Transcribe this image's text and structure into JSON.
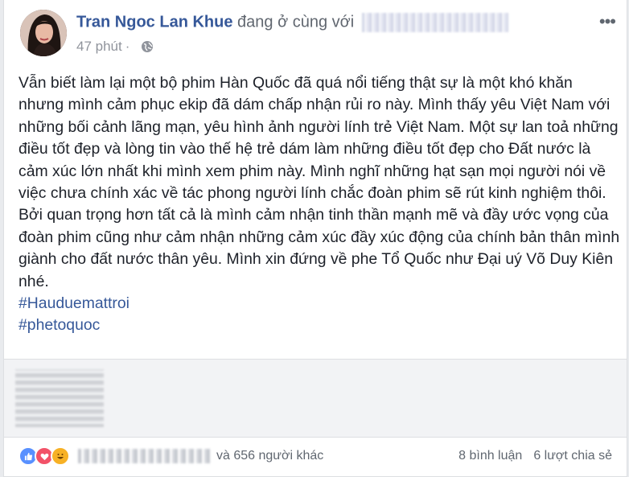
{
  "post": {
    "author": "Tran Ngoc Lan Khue",
    "with_text": "đang ở cùng với",
    "time": "47 phút",
    "privacy_icon": "globe-icon",
    "more_icon": "more-icon",
    "body": "Vẫn biết làm lại một bộ phim Hàn Quốc đã quá nổi tiếng thật sự là một khó khăn nhưng mình cảm phục ekip đã dám chấp nhận rủi ro này. Mình thấy yêu Việt Nam với những bối cảnh lãng mạn, yêu hình ảnh người lính trẻ Việt Nam. Một sự lan toả những điều tốt đẹp và lòng tin vào thế hệ trẻ dám làm những điều tốt đẹp cho Đất nước là cảm xúc lớn nhất khi mình xem phim này. Mình nghĩ những hạt sạn mọi người nói về việc chưa chính xác về tác phong người lính chắc đoàn phim sẽ rút kinh nghiệm thôi. Bởi quan trọng hơn tất cả là mình cảm nhận tinh thần mạnh mẽ và đầy ước vọng của đoàn phim cũng như cảm nhận những cảm xúc đầy xúc động của chính bản thân mình giành cho đất nước thân yêu. Mình xin đứng về phe Tổ Quốc như Đại uý Võ Duy Kiên nhé.",
    "hashtags": [
      "#Hauduemattroi",
      "#phetoquoc"
    ]
  },
  "footer": {
    "reaction_icons": [
      "like-icon",
      "love-icon",
      "haha-icon"
    ],
    "others_text": "và 656 người khác",
    "comments": "8 bình luận",
    "shares": "6 lượt chia sẻ"
  },
  "colors": {
    "link": "#365899",
    "muted": "#90949c",
    "background": "#e9ebee"
  }
}
